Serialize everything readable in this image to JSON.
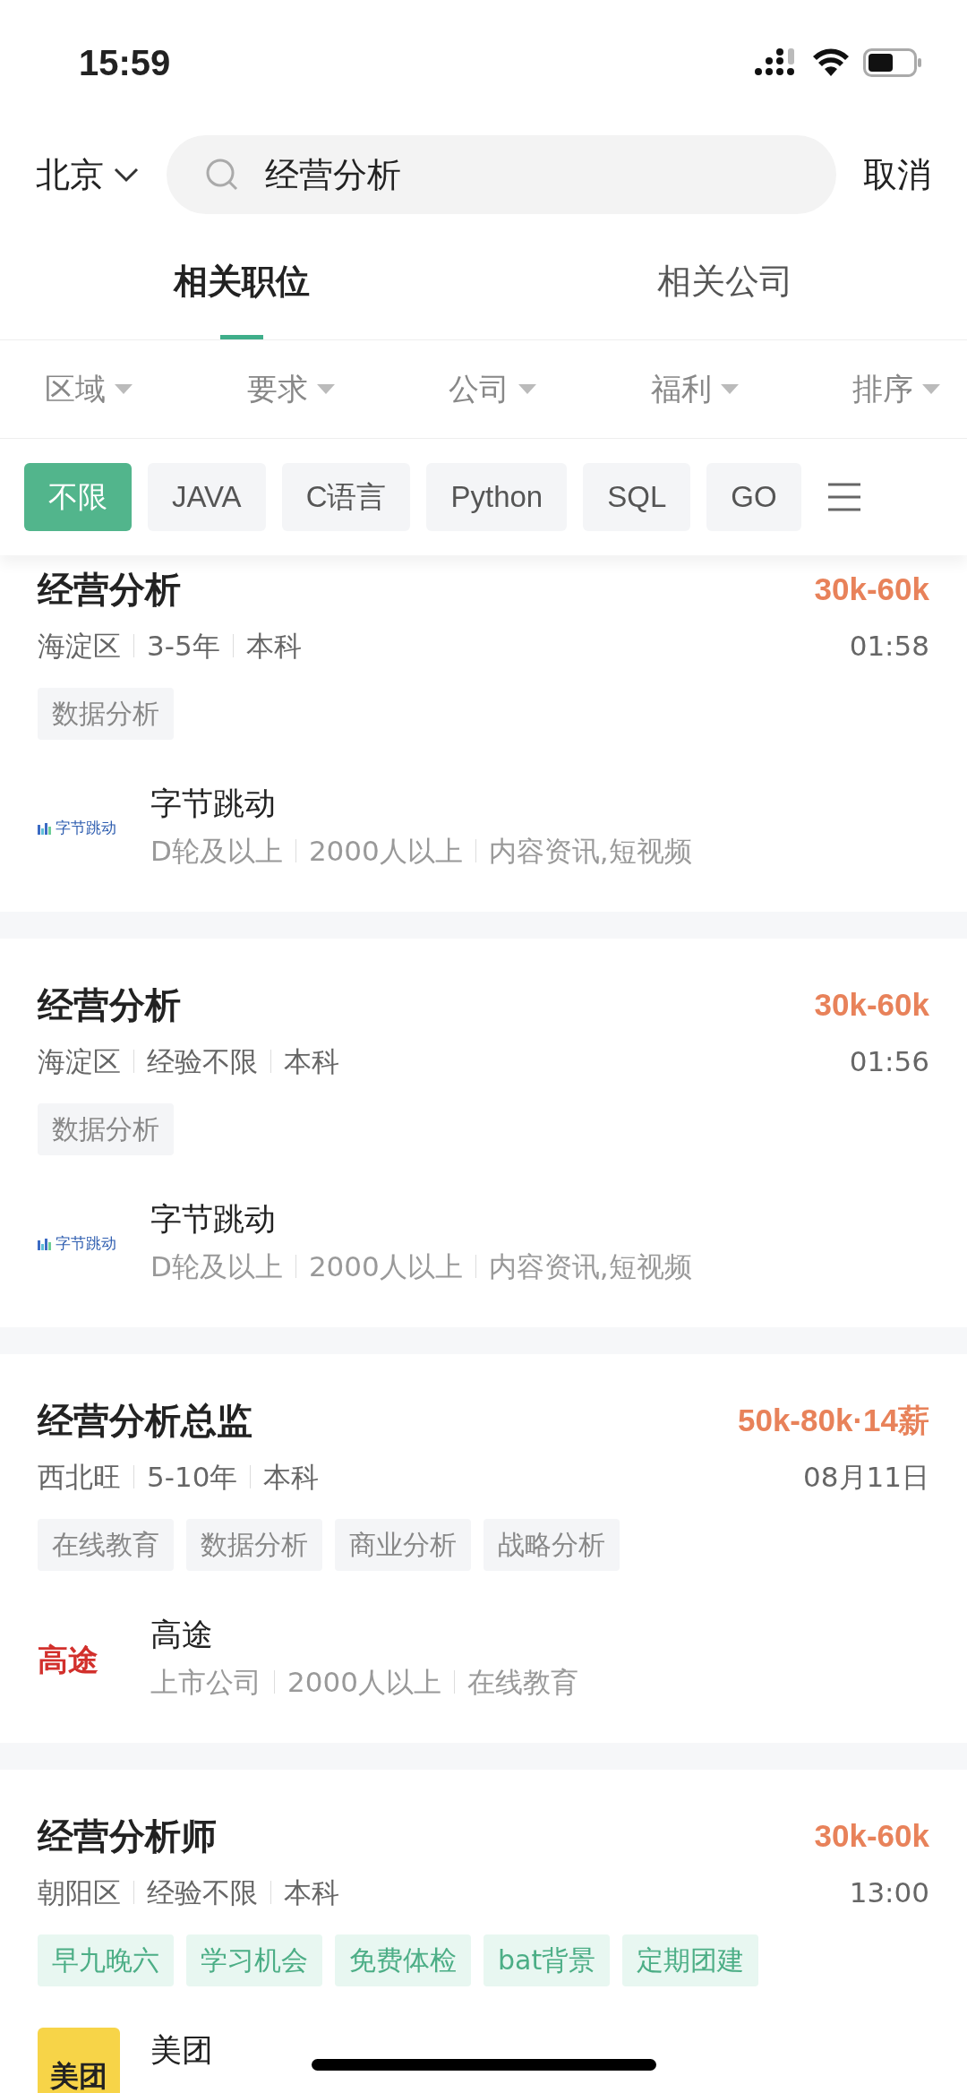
{
  "status_bar": {
    "time": "15:59"
  },
  "search": {
    "city": "北京",
    "value": "经营分析",
    "cancel": "取消"
  },
  "tabs": [
    {
      "label": "相关职位",
      "selected": true
    },
    {
      "label": "相关公司",
      "selected": false
    }
  ],
  "filters": [
    "区域",
    "要求",
    "公司",
    "福利",
    "排序"
  ],
  "chips": [
    {
      "label": "不限",
      "selected": true
    },
    {
      "label": "JAVA",
      "selected": false
    },
    {
      "label": "C语言",
      "selected": false
    },
    {
      "label": "Python",
      "selected": false
    },
    {
      "label": "SQL",
      "selected": false
    },
    {
      "label": "GO",
      "selected": false
    }
  ],
  "jobs": [
    {
      "title": "经营分析",
      "salary": "30k-60k",
      "meta": [
        "海淀区",
        "3-5年",
        "本科"
      ],
      "time": "01:58",
      "tags": [
        {
          "label": "数据分析",
          "kind": "skill"
        }
      ],
      "company": {
        "name": "字节跳动",
        "logo": {
          "kind": "bars",
          "text": "字节跳动"
        },
        "info": [
          "D轮及以上",
          "2000人以上",
          "内容资讯,短视频"
        ]
      }
    },
    {
      "title": "经营分析",
      "salary": "30k-60k",
      "meta": [
        "海淀区",
        "经验不限",
        "本科"
      ],
      "time": "01:56",
      "tags": [
        {
          "label": "数据分析",
          "kind": "skill"
        }
      ],
      "company": {
        "name": "字节跳动",
        "logo": {
          "kind": "bars",
          "text": "字节跳动"
        },
        "info": [
          "D轮及以上",
          "2000人以上",
          "内容资讯,短视频"
        ]
      }
    },
    {
      "title": "经营分析总监",
      "salary": "50k-80k·14薪",
      "meta": [
        "西北旺",
        "5-10年",
        "本科"
      ],
      "time": "08月11日",
      "tags": [
        {
          "label": "在线教育",
          "kind": "skill"
        },
        {
          "label": "数据分析",
          "kind": "skill"
        },
        {
          "label": "商业分析",
          "kind": "skill"
        },
        {
          "label": "战略分析",
          "kind": "skill"
        }
      ],
      "company": {
        "name": "高途",
        "logo": {
          "kind": "wordmark",
          "text": "高途"
        },
        "info": [
          "上市公司",
          "2000人以上",
          "在线教育"
        ]
      }
    },
    {
      "title": "经营分析师",
      "salary": "30k-60k",
      "meta": [
        "朝阳区",
        "经验不限",
        "本科"
      ],
      "time": "13:00",
      "tags": [
        {
          "label": "早九晚六",
          "kind": "benefit"
        },
        {
          "label": "学习机会",
          "kind": "benefit"
        },
        {
          "label": "免费体检",
          "kind": "benefit"
        },
        {
          "label": "bat背景",
          "kind": "benefit"
        },
        {
          "label": "定期团建",
          "kind": "benefit"
        }
      ],
      "company": {
        "name": "美团",
        "logo": {
          "kind": "badge",
          "text": "美团"
        }
      }
    }
  ]
}
